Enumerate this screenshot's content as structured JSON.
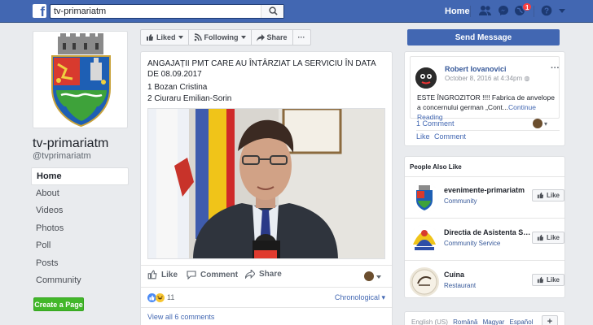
{
  "topbar": {
    "search_value": "tv-primariatm",
    "home_label": "Home",
    "notification_count": "1"
  },
  "left": {
    "page_name": "tv-primariatm",
    "page_handle": "@tvprimariatm",
    "nav": [
      "Home",
      "About",
      "Videos",
      "Photos",
      "Poll",
      "Posts",
      "Community"
    ],
    "create_page": "Create a Page"
  },
  "actions": {
    "liked": "Liked",
    "following": "Following",
    "share": "Share",
    "more": "···"
  },
  "post": {
    "title": "ANGAJAȚII PMT CARE AU ÎNTÂRZIAT LA SERVICIU ÎN DATA DE 08.09.2017",
    "line1": "1 Bozan Cristina",
    "line2": "2 Ciuraru Emilian-Sorin",
    "like": "Like",
    "comment": "Comment",
    "share": "Share",
    "reaction_count": "11",
    "order": "Chronological",
    "view_all": "View all 6 comments"
  },
  "send_message": "Send Message",
  "recent": {
    "author": "Robert Iovanovici",
    "date": "October 8, 2016 at 4:34pm",
    "text": "ESTE ÎNGROZITOR !!!! Fabrica de anvelope a concernului german „Cont...",
    "continue": "Continue Reading",
    "comment_count": "1 Comment",
    "like": "Like",
    "comment": "Comment"
  },
  "people_also_like": {
    "title": "People Also Like",
    "items": [
      {
        "name": "evenimente-primariatm",
        "category": "Community",
        "like": "Like"
      },
      {
        "name": "Directia de Asistenta Sociala",
        "category": "Community Service",
        "like": "Like"
      },
      {
        "name": "Cuina",
        "category": "Restaurant",
        "like": "Like"
      }
    ]
  },
  "languages": {
    "current": "English (US)",
    "others": [
      "Română",
      "Magyar",
      "Español"
    ],
    "more": "+"
  },
  "colors": {
    "brand": "#4267b2",
    "link": "#365899",
    "green": "#42b72a",
    "background": "#e9ebee"
  }
}
